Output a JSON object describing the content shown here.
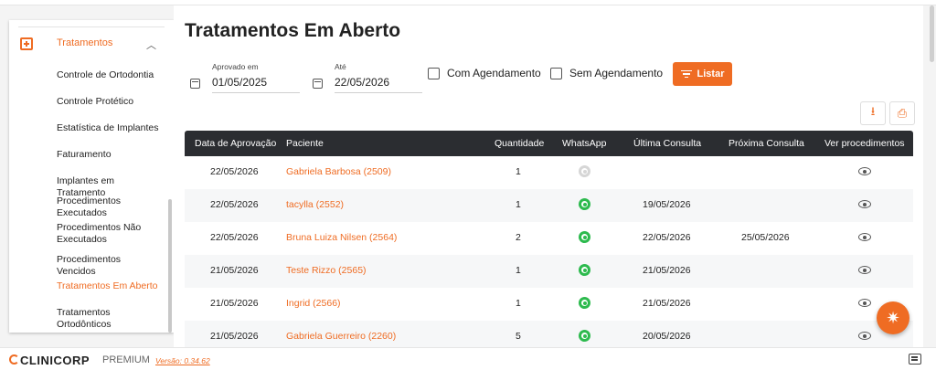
{
  "sidebar": {
    "section_label": "Tratamentos",
    "chevron": "chevron-up-icon",
    "items": [
      "Controle de Ortodontia",
      "Controle Protético",
      "Estatística de Implantes",
      "Faturamento",
      "Implantes em Tratamento",
      "Procedimentos Executados",
      "Procedimentos Não Executados",
      "Procedimentos Vencidos",
      "Tratamentos Em Aberto",
      "Tratamentos Ortodônticos"
    ],
    "active_item": "Tratamentos Em Aberto"
  },
  "page": {
    "title": "Tratamentos Em Aberto"
  },
  "filters": {
    "approved_label": "Aprovado em",
    "approved_value": "01/05/2025",
    "until_label": "Até",
    "until_value": "22/05/2026",
    "with_schedule_label": "Com Agendamento",
    "without_schedule_label": "Sem Agendamento",
    "list_button_label": "Listar"
  },
  "table": {
    "headers": [
      "Data de Aprovação",
      "Paciente",
      "Quantidade",
      "WhatsApp",
      "Última Consulta",
      "Próxima Consulta",
      "Ver procedimentos"
    ],
    "rows": [
      {
        "date": "22/05/2026",
        "patient": "Gabriela Barbosa (2509)",
        "qty": "1",
        "whatsapp": false,
        "last": "",
        "next": ""
      },
      {
        "date": "22/05/2026",
        "patient": "tacylla (2552)",
        "qty": "1",
        "whatsapp": true,
        "last": "19/05/2026",
        "next": ""
      },
      {
        "date": "22/05/2026",
        "patient": "Bruna Luiza Nilsen (2564)",
        "qty": "2",
        "whatsapp": true,
        "last": "22/05/2026",
        "next": "25/05/2026"
      },
      {
        "date": "21/05/2026",
        "patient": "Teste Rizzo (2565)",
        "qty": "1",
        "whatsapp": true,
        "last": "21/05/2026",
        "next": ""
      },
      {
        "date": "21/05/2026",
        "patient": "Ingrid (2566)",
        "qty": "1",
        "whatsapp": true,
        "last": "21/05/2026",
        "next": ""
      },
      {
        "date": "21/05/2026",
        "patient": "Gabriela Guerreiro (2260)",
        "qty": "5",
        "whatsapp": true,
        "last": "20/05/2026",
        "next": ""
      }
    ]
  },
  "footer": {
    "brand": "CLINICORP",
    "plan": "PREMIUM",
    "version": "Versão: 0.34.62"
  },
  "colors": {
    "accent": "#ef6c23",
    "header_bg": "#2b2d31",
    "whatsapp": "#2dba4e"
  }
}
